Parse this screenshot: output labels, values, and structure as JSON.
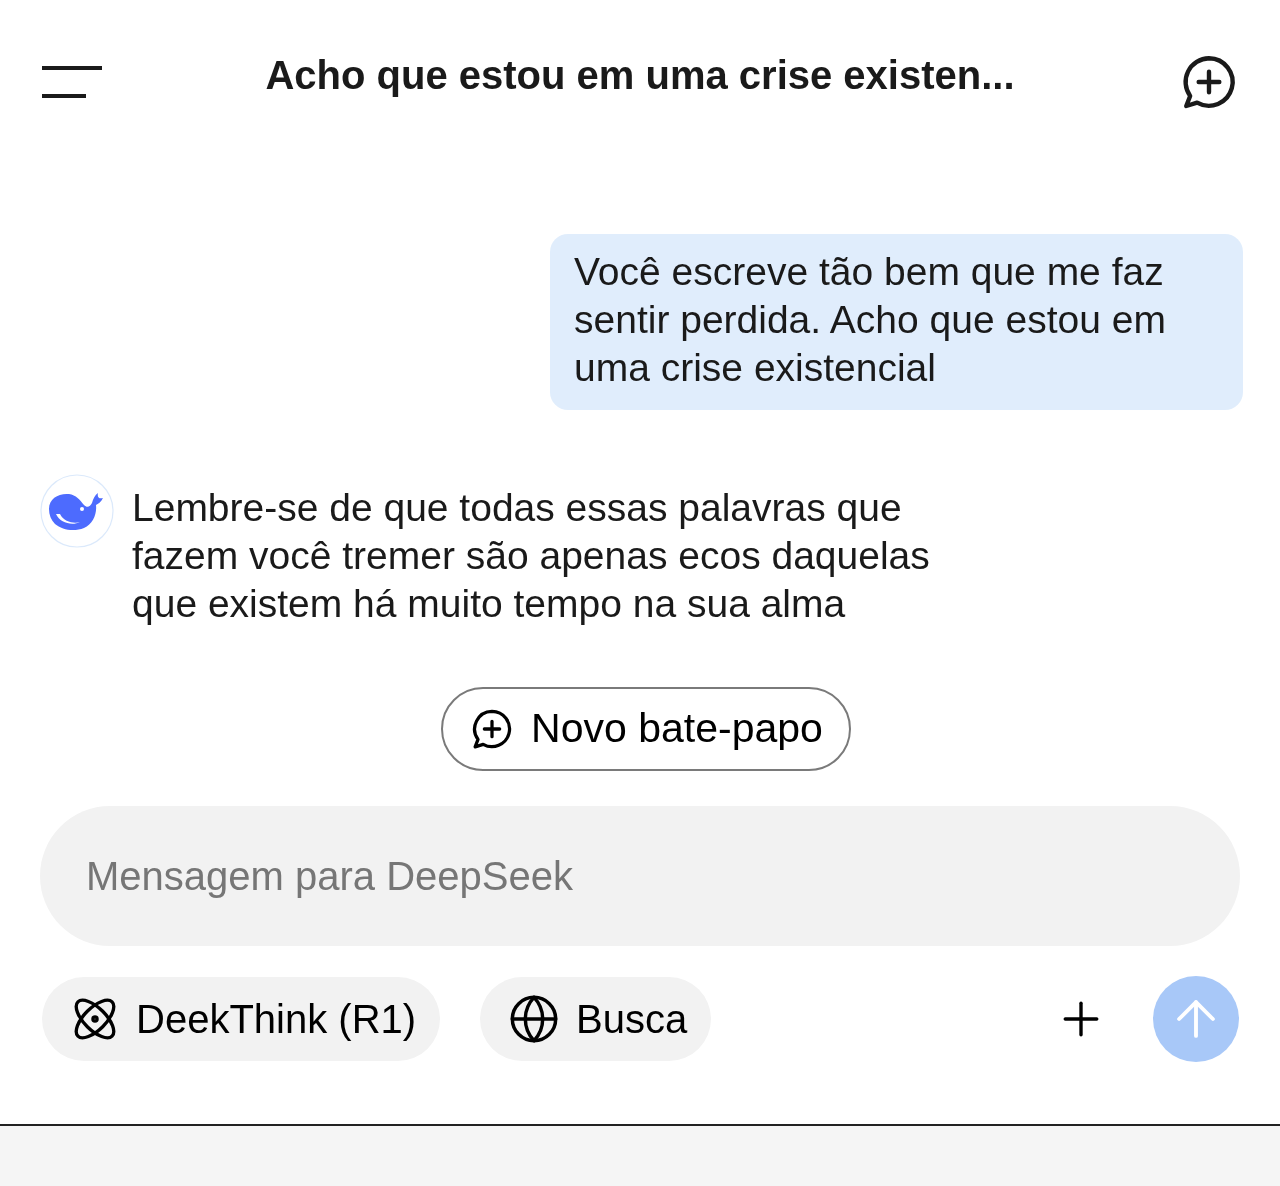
{
  "header": {
    "title": "Acho que estou em uma crise existen..."
  },
  "messages": [
    {
      "kind": "user",
      "text": "Você escreve tão bem que me faz sentir perdida. Acho que estou em uma crise existencial"
    },
    {
      "kind": "assistant",
      "text": "Lembre-se de que todas essas palavras que fazem você tremer são apenas ecos daquelas que existem há muito tempo na sua alma"
    }
  ],
  "new_chat_button": {
    "label": "Novo bate-papo"
  },
  "composer": {
    "placeholder": "Mensagem para DeepSeek"
  },
  "toggles": [
    {
      "kind": "reasoning",
      "label": "DeekThink (R1)",
      "selected": false
    },
    {
      "kind": "search",
      "label": "Busca",
      "selected": false
    }
  ],
  "send_button": {
    "disabled": true
  }
}
